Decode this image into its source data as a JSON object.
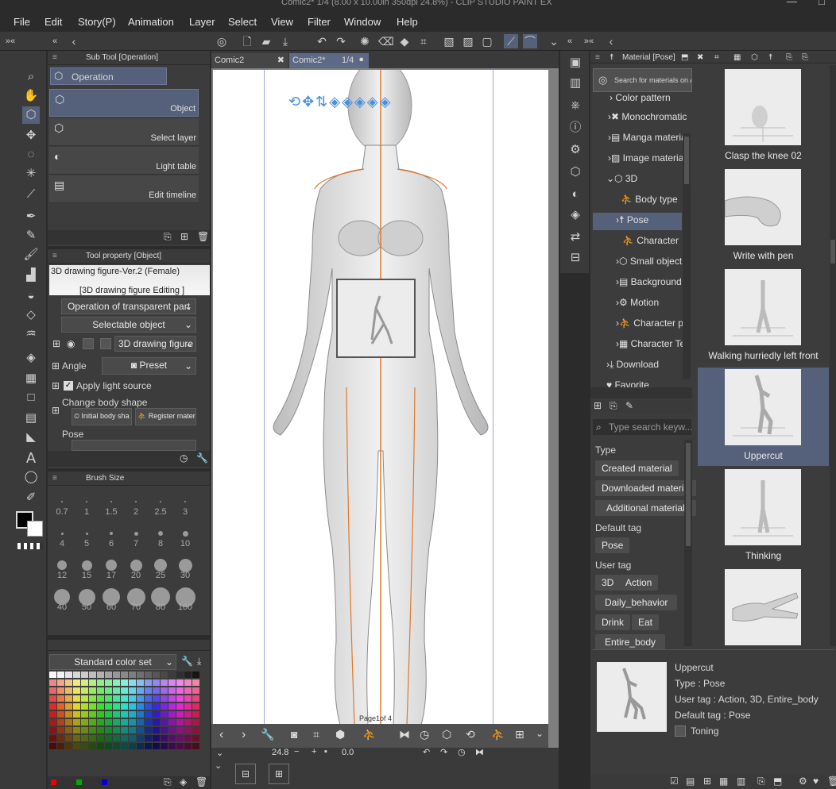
{
  "app": {
    "title": "Comic2* 1/4 (8.00 x 10.00in 350dpi 24.8%)  - CLIP STUDIO PAINT EX"
  },
  "menu": [
    "File",
    "Edit",
    "Story(P)",
    "Animation",
    "Layer",
    "Select",
    "View",
    "Filter",
    "Window",
    "Help"
  ],
  "subtool": {
    "header": "Sub Tool [Operation]",
    "group": "Operation",
    "items": [
      "Object",
      "Select layer",
      "Light table",
      "Edit timeline"
    ]
  },
  "toolprop": {
    "header": "Tool property [Object]",
    "figure": "3D drawing figure-Ver.2 (Female)",
    "editing": "[3D drawing figure Editing ]",
    "transparent": "Operation of transparent part",
    "selectable": "Selectable object",
    "layer_item": "3D drawing figure",
    "angle": "Angle",
    "preset": "Preset",
    "light": "Apply light source",
    "body_shape": "Change body shape",
    "initial": "Initial body sha",
    "register": "Register mater",
    "pose": "Pose"
  },
  "brush": {
    "header": "Brush Size",
    "sizes": [
      "0.7",
      "1",
      "1.5",
      "2",
      "2.5",
      "3",
      "4",
      "5",
      "6",
      "7",
      "8",
      "10",
      "12",
      "15",
      "17",
      "20",
      "25",
      "30",
      "40",
      "50",
      "60",
      "70",
      "80",
      "100"
    ]
  },
  "colorset": {
    "name": "Standard color set"
  },
  "tabs": [
    {
      "label": "Comic2"
    },
    {
      "label": "Comic2*",
      "page": "1/4"
    }
  ],
  "canvas": {
    "page_label": "Page1of 4",
    "zoom": "24.8",
    "angle": "0.0"
  },
  "material": {
    "header": "Material [Pose]",
    "search_as": "Search for materials on AS",
    "tree": [
      "Color pattern",
      "Monochromatic",
      "Manga material",
      "Image material",
      "3D",
      "Body type",
      "Pose",
      "Character",
      "Small object",
      "Background",
      "Motion",
      "Character pa",
      "Character Te",
      "Download",
      "Favorite"
    ],
    "search_placeholder": "Type search keyw...",
    "type_label": "Type",
    "types": [
      "Created material",
      "Downloaded material",
      "Additional material"
    ],
    "default_tag_label": "Default tag",
    "default_tags": [
      "Pose"
    ],
    "user_tag_label": "User tag",
    "user_tags": [
      "3D",
      "Action",
      "Daily_behavior",
      "Drink",
      "Eat",
      "Entire_body"
    ],
    "items": [
      "Clasp the knee 02",
      "Write with pen",
      "Walking hurriedly left front",
      "Uppercut",
      "Thinking"
    ],
    "detail": {
      "name": "Uppercut",
      "type": "Type : Pose",
      "user_tag": "User tag : Action, 3D, Entire_body",
      "default_tag": "Default tag : Pose",
      "toning": "Toning"
    }
  },
  "colors": {
    "accent": "#55607a",
    "panel": "#3c3c3c",
    "figure_outline": "#e0782a",
    "gizmo": "#4a90d9"
  }
}
